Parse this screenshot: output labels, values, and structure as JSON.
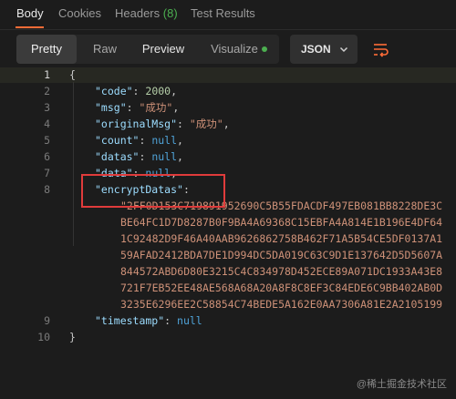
{
  "tabs": [
    {
      "label": "Body"
    },
    {
      "label": "Cookies"
    },
    {
      "label": "Headers",
      "count": "(8)"
    },
    {
      "label": "Test Results"
    }
  ],
  "view": {
    "modes": [
      "Pretty",
      "Raw",
      "Preview",
      "Visualize"
    ],
    "format": "JSON"
  },
  "colors": {
    "accent": "#ff6c37",
    "annotation": "#e03b3b",
    "status_dot": "#4caf50"
  },
  "icons": [
    "chevron-down-icon",
    "wrap-lines-icon",
    "status-dot-icon"
  ],
  "editor": {
    "line_numbers": [
      "1",
      "2",
      "3",
      "4",
      "5",
      "6",
      "7",
      "8",
      "9",
      "10"
    ],
    "open_brace": "{",
    "close_brace": "}",
    "code_key": "\"code\"",
    "code_val": "2000",
    "msg_key": "\"msg\"",
    "msg_val": "\"成功\"",
    "orig_key": "\"originalMsg\"",
    "orig_val": "\"成功\"",
    "count_key": "\"count\"",
    "datas_key": "\"datas\"",
    "data_key": "\"data\"",
    "null_val": "null",
    "encrypt_key": "\"encryptDatas\"",
    "encrypt_lines": [
      "\"2FF0D153C719891952690C5B55FDACDF497EB081BB8228DE3C",
      "BE64FC1D7D8287B0F9BA4A69368C15EBFA4A814E1B196E4DF64",
      "1C92482D9F46A40AAB9626862758B462F71A5B54CE5DF0137A1",
      "59AFAD2412BDA7DE1D994DC5DA019C63C9D1E137642D5D5607A",
      "844572ABD6D80E3215C4C834978D452ECE89A071DC1933A43E8",
      "721F7EB52EE48AE568A68A20A8F8C8EF3C84EDE6C9BB402AB0D",
      "3235E6296EE2C58854C74BEDE5A162E0AA7306A81E2A2105199"
    ],
    "timestamp_key": "\"timestamp\""
  },
  "watermark": "@稀土掘金技术社区"
}
